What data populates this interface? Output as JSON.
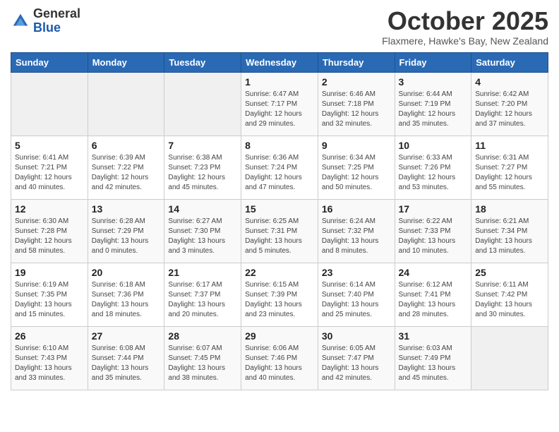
{
  "logo": {
    "general": "General",
    "blue": "Blue"
  },
  "header": {
    "month": "October 2025",
    "location": "Flaxmere, Hawke's Bay, New Zealand"
  },
  "days_of_week": [
    "Sunday",
    "Monday",
    "Tuesday",
    "Wednesday",
    "Thursday",
    "Friday",
    "Saturday"
  ],
  "weeks": [
    [
      {
        "day": "",
        "info": ""
      },
      {
        "day": "",
        "info": ""
      },
      {
        "day": "",
        "info": ""
      },
      {
        "day": "1",
        "info": "Sunrise: 6:47 AM\nSunset: 7:17 PM\nDaylight: 12 hours\nand 29 minutes."
      },
      {
        "day": "2",
        "info": "Sunrise: 6:46 AM\nSunset: 7:18 PM\nDaylight: 12 hours\nand 32 minutes."
      },
      {
        "day": "3",
        "info": "Sunrise: 6:44 AM\nSunset: 7:19 PM\nDaylight: 12 hours\nand 35 minutes."
      },
      {
        "day": "4",
        "info": "Sunrise: 6:42 AM\nSunset: 7:20 PM\nDaylight: 12 hours\nand 37 minutes."
      }
    ],
    [
      {
        "day": "5",
        "info": "Sunrise: 6:41 AM\nSunset: 7:21 PM\nDaylight: 12 hours\nand 40 minutes."
      },
      {
        "day": "6",
        "info": "Sunrise: 6:39 AM\nSunset: 7:22 PM\nDaylight: 12 hours\nand 42 minutes."
      },
      {
        "day": "7",
        "info": "Sunrise: 6:38 AM\nSunset: 7:23 PM\nDaylight: 12 hours\nand 45 minutes."
      },
      {
        "day": "8",
        "info": "Sunrise: 6:36 AM\nSunset: 7:24 PM\nDaylight: 12 hours\nand 47 minutes."
      },
      {
        "day": "9",
        "info": "Sunrise: 6:34 AM\nSunset: 7:25 PM\nDaylight: 12 hours\nand 50 minutes."
      },
      {
        "day": "10",
        "info": "Sunrise: 6:33 AM\nSunset: 7:26 PM\nDaylight: 12 hours\nand 53 minutes."
      },
      {
        "day": "11",
        "info": "Sunrise: 6:31 AM\nSunset: 7:27 PM\nDaylight: 12 hours\nand 55 minutes."
      }
    ],
    [
      {
        "day": "12",
        "info": "Sunrise: 6:30 AM\nSunset: 7:28 PM\nDaylight: 12 hours\nand 58 minutes."
      },
      {
        "day": "13",
        "info": "Sunrise: 6:28 AM\nSunset: 7:29 PM\nDaylight: 13 hours\nand 0 minutes."
      },
      {
        "day": "14",
        "info": "Sunrise: 6:27 AM\nSunset: 7:30 PM\nDaylight: 13 hours\nand 3 minutes."
      },
      {
        "day": "15",
        "info": "Sunrise: 6:25 AM\nSunset: 7:31 PM\nDaylight: 13 hours\nand 5 minutes."
      },
      {
        "day": "16",
        "info": "Sunrise: 6:24 AM\nSunset: 7:32 PM\nDaylight: 13 hours\nand 8 minutes."
      },
      {
        "day": "17",
        "info": "Sunrise: 6:22 AM\nSunset: 7:33 PM\nDaylight: 13 hours\nand 10 minutes."
      },
      {
        "day": "18",
        "info": "Sunrise: 6:21 AM\nSunset: 7:34 PM\nDaylight: 13 hours\nand 13 minutes."
      }
    ],
    [
      {
        "day": "19",
        "info": "Sunrise: 6:19 AM\nSunset: 7:35 PM\nDaylight: 13 hours\nand 15 minutes."
      },
      {
        "day": "20",
        "info": "Sunrise: 6:18 AM\nSunset: 7:36 PM\nDaylight: 13 hours\nand 18 minutes."
      },
      {
        "day": "21",
        "info": "Sunrise: 6:17 AM\nSunset: 7:37 PM\nDaylight: 13 hours\nand 20 minutes."
      },
      {
        "day": "22",
        "info": "Sunrise: 6:15 AM\nSunset: 7:39 PM\nDaylight: 13 hours\nand 23 minutes."
      },
      {
        "day": "23",
        "info": "Sunrise: 6:14 AM\nSunset: 7:40 PM\nDaylight: 13 hours\nand 25 minutes."
      },
      {
        "day": "24",
        "info": "Sunrise: 6:12 AM\nSunset: 7:41 PM\nDaylight: 13 hours\nand 28 minutes."
      },
      {
        "day": "25",
        "info": "Sunrise: 6:11 AM\nSunset: 7:42 PM\nDaylight: 13 hours\nand 30 minutes."
      }
    ],
    [
      {
        "day": "26",
        "info": "Sunrise: 6:10 AM\nSunset: 7:43 PM\nDaylight: 13 hours\nand 33 minutes."
      },
      {
        "day": "27",
        "info": "Sunrise: 6:08 AM\nSunset: 7:44 PM\nDaylight: 13 hours\nand 35 minutes."
      },
      {
        "day": "28",
        "info": "Sunrise: 6:07 AM\nSunset: 7:45 PM\nDaylight: 13 hours\nand 38 minutes."
      },
      {
        "day": "29",
        "info": "Sunrise: 6:06 AM\nSunset: 7:46 PM\nDaylight: 13 hours\nand 40 minutes."
      },
      {
        "day": "30",
        "info": "Sunrise: 6:05 AM\nSunset: 7:47 PM\nDaylight: 13 hours\nand 42 minutes."
      },
      {
        "day": "31",
        "info": "Sunrise: 6:03 AM\nSunset: 7:49 PM\nDaylight: 13 hours\nand 45 minutes."
      },
      {
        "day": "",
        "info": ""
      }
    ]
  ]
}
